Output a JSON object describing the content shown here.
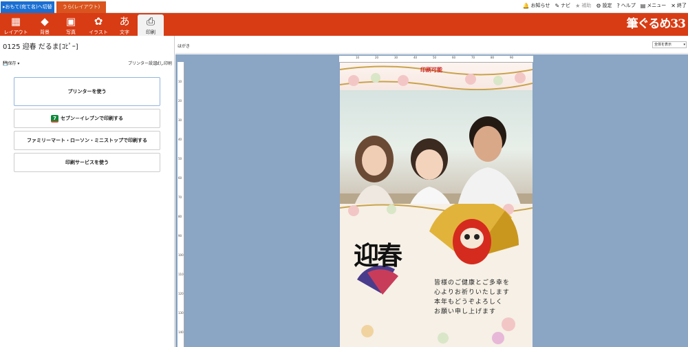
{
  "tabs": {
    "front": "▸おもて(宛て名)へ切替",
    "back": "うら(レイアウト)"
  },
  "top_links": [
    {
      "icon": "notice-icon",
      "glyph": "🔔",
      "label": "お知らせ",
      "enabled": true
    },
    {
      "icon": "navi-icon",
      "glyph": "✎",
      "label": "ナビ",
      "enabled": true
    },
    {
      "icon": "star-icon",
      "glyph": "★",
      "label": "補助",
      "enabled": false
    },
    {
      "icon": "gear-icon",
      "glyph": "⚙",
      "label": "設定",
      "enabled": true
    },
    {
      "icon": "help-icon",
      "glyph": "?",
      "label": "ヘルプ",
      "enabled": true
    },
    {
      "icon": "menu-icon",
      "glyph": "▤",
      "label": "メニュー",
      "enabled": true
    },
    {
      "icon": "close-icon",
      "glyph": "✕",
      "label": "終了",
      "enabled": true
    }
  ],
  "toolbar": [
    {
      "icon": "layout-icon",
      "glyph": "▦",
      "label": "レイアウト"
    },
    {
      "icon": "background-icon",
      "glyph": "◆",
      "label": "背景"
    },
    {
      "icon": "photo-icon",
      "glyph": "▣",
      "label": "写真"
    },
    {
      "icon": "illust-icon",
      "glyph": "✿",
      "label": "イラスト"
    },
    {
      "icon": "text-icon",
      "glyph": "あ",
      "label": "文字"
    },
    {
      "icon": "print-icon",
      "glyph": "⎙",
      "label": "印刷"
    }
  ],
  "brand": "筆ぐるめ33",
  "document_title": "0125 迎春 だるま[ｺﾋﾟｰ]",
  "subbar": {
    "save": "保存",
    "printer_settings": "プリンター設定",
    "trial_print": "試し印刷"
  },
  "print_buttons": [
    {
      "label": "プリンターを使う"
    },
    {
      "label": "セブン－イレブンで印刷する"
    },
    {
      "label": "ファミリーマート・ローソン・ミニストップで印刷する"
    },
    {
      "label": "印刷サービスを使う"
    }
  ],
  "canvas": {
    "paper": "はがき",
    "view_select": "全体を表示"
  },
  "ruler_h": [
    "10",
    "20",
    "30",
    "40",
    "50",
    "60",
    "70",
    "80",
    "90"
  ],
  "ruler_v": [
    "10",
    "20",
    "30",
    "40",
    "50",
    "60",
    "70",
    "80",
    "90",
    "100",
    "110",
    "120",
    "130",
    "140"
  ],
  "card": {
    "printable_label": "印刷可能",
    "greeting_title": "迎春",
    "greeting_lines": [
      "皆様のご健康とご多幸を",
      "心よりお祈りいたします",
      "本年もどうぞよろしく",
      "お願い申し上げます"
    ]
  }
}
